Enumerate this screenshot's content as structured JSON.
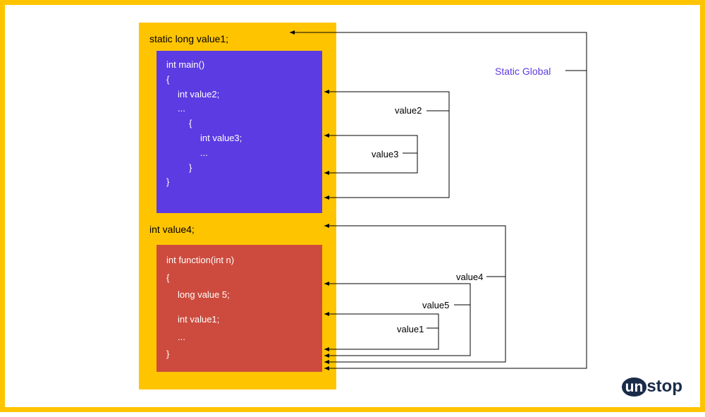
{
  "diagram": {
    "static_decl": "static long value1;",
    "global_decl": "int value4;",
    "main_block": {
      "line1": "int main()",
      "line2": "{",
      "line3": "int value2;",
      "line4": "...",
      "line5": "{",
      "line6": "int value3;",
      "line7": "...",
      "line8": "}",
      "line9": "}"
    },
    "func_block": {
      "line1": "int function(int n)",
      "line2": "{",
      "line3": "long value 5;",
      "line4": "int value1;",
      "line5": "...",
      "line6": "}"
    },
    "labels": {
      "static_global": "Static Global",
      "value2": "value2",
      "value3": "value3",
      "value4": "value4",
      "value5": "value5",
      "value1": "value1"
    }
  },
  "logo": {
    "prefix": "un",
    "suffix": "stop"
  }
}
